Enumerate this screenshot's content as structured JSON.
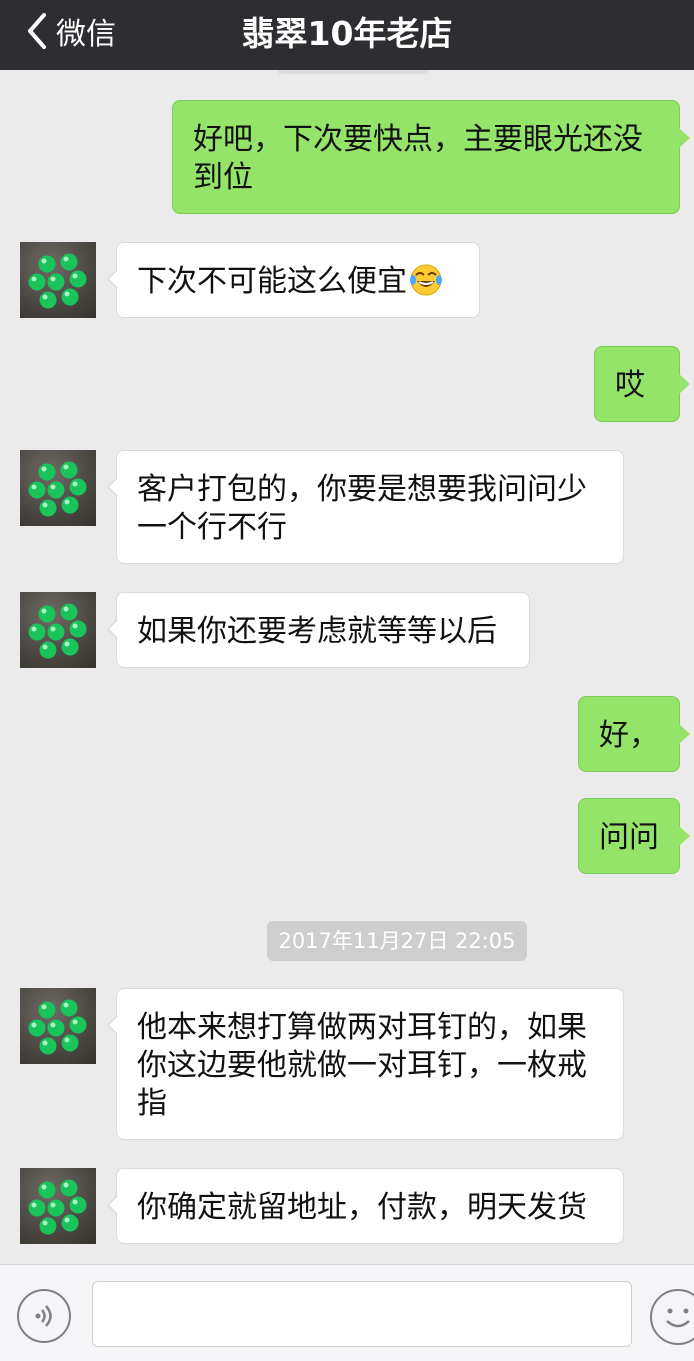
{
  "header": {
    "back_label": "微信",
    "title": "翡翠10年老店"
  },
  "messages": [
    {
      "side": "out",
      "text": "好吧，下次要快点，主要眼光还没到位"
    },
    {
      "side": "in",
      "text": "下次不可能这么便宜",
      "emoji": "tears-of-joy"
    },
    {
      "side": "out",
      "text": "哎"
    },
    {
      "side": "in",
      "text": "客户打包的，你要是想要我问问少一个行不行"
    },
    {
      "side": "in",
      "text": "如果你还要考虑就等等以后"
    },
    {
      "side": "out",
      "text": "好，"
    },
    {
      "side": "out",
      "text": "问问"
    },
    {
      "side": "timestamp",
      "text": "2017年11月27日 22:05"
    },
    {
      "side": "in",
      "text": "他本来想打算做两对耳钉的，如果你这边要他就做一对耳钉，一枚戒指"
    },
    {
      "side": "in",
      "text": "你确定就留地址，付款，明天发货"
    }
  ],
  "input": {
    "placeholder": "",
    "voice_icon": "voice-icon",
    "emoji_icon": "emoji-icon"
  },
  "colors": {
    "header_bg": "#2e2e32",
    "chat_bg": "#ebebeb",
    "out_bubble": "#95e46a",
    "in_bubble": "#ffffff"
  }
}
